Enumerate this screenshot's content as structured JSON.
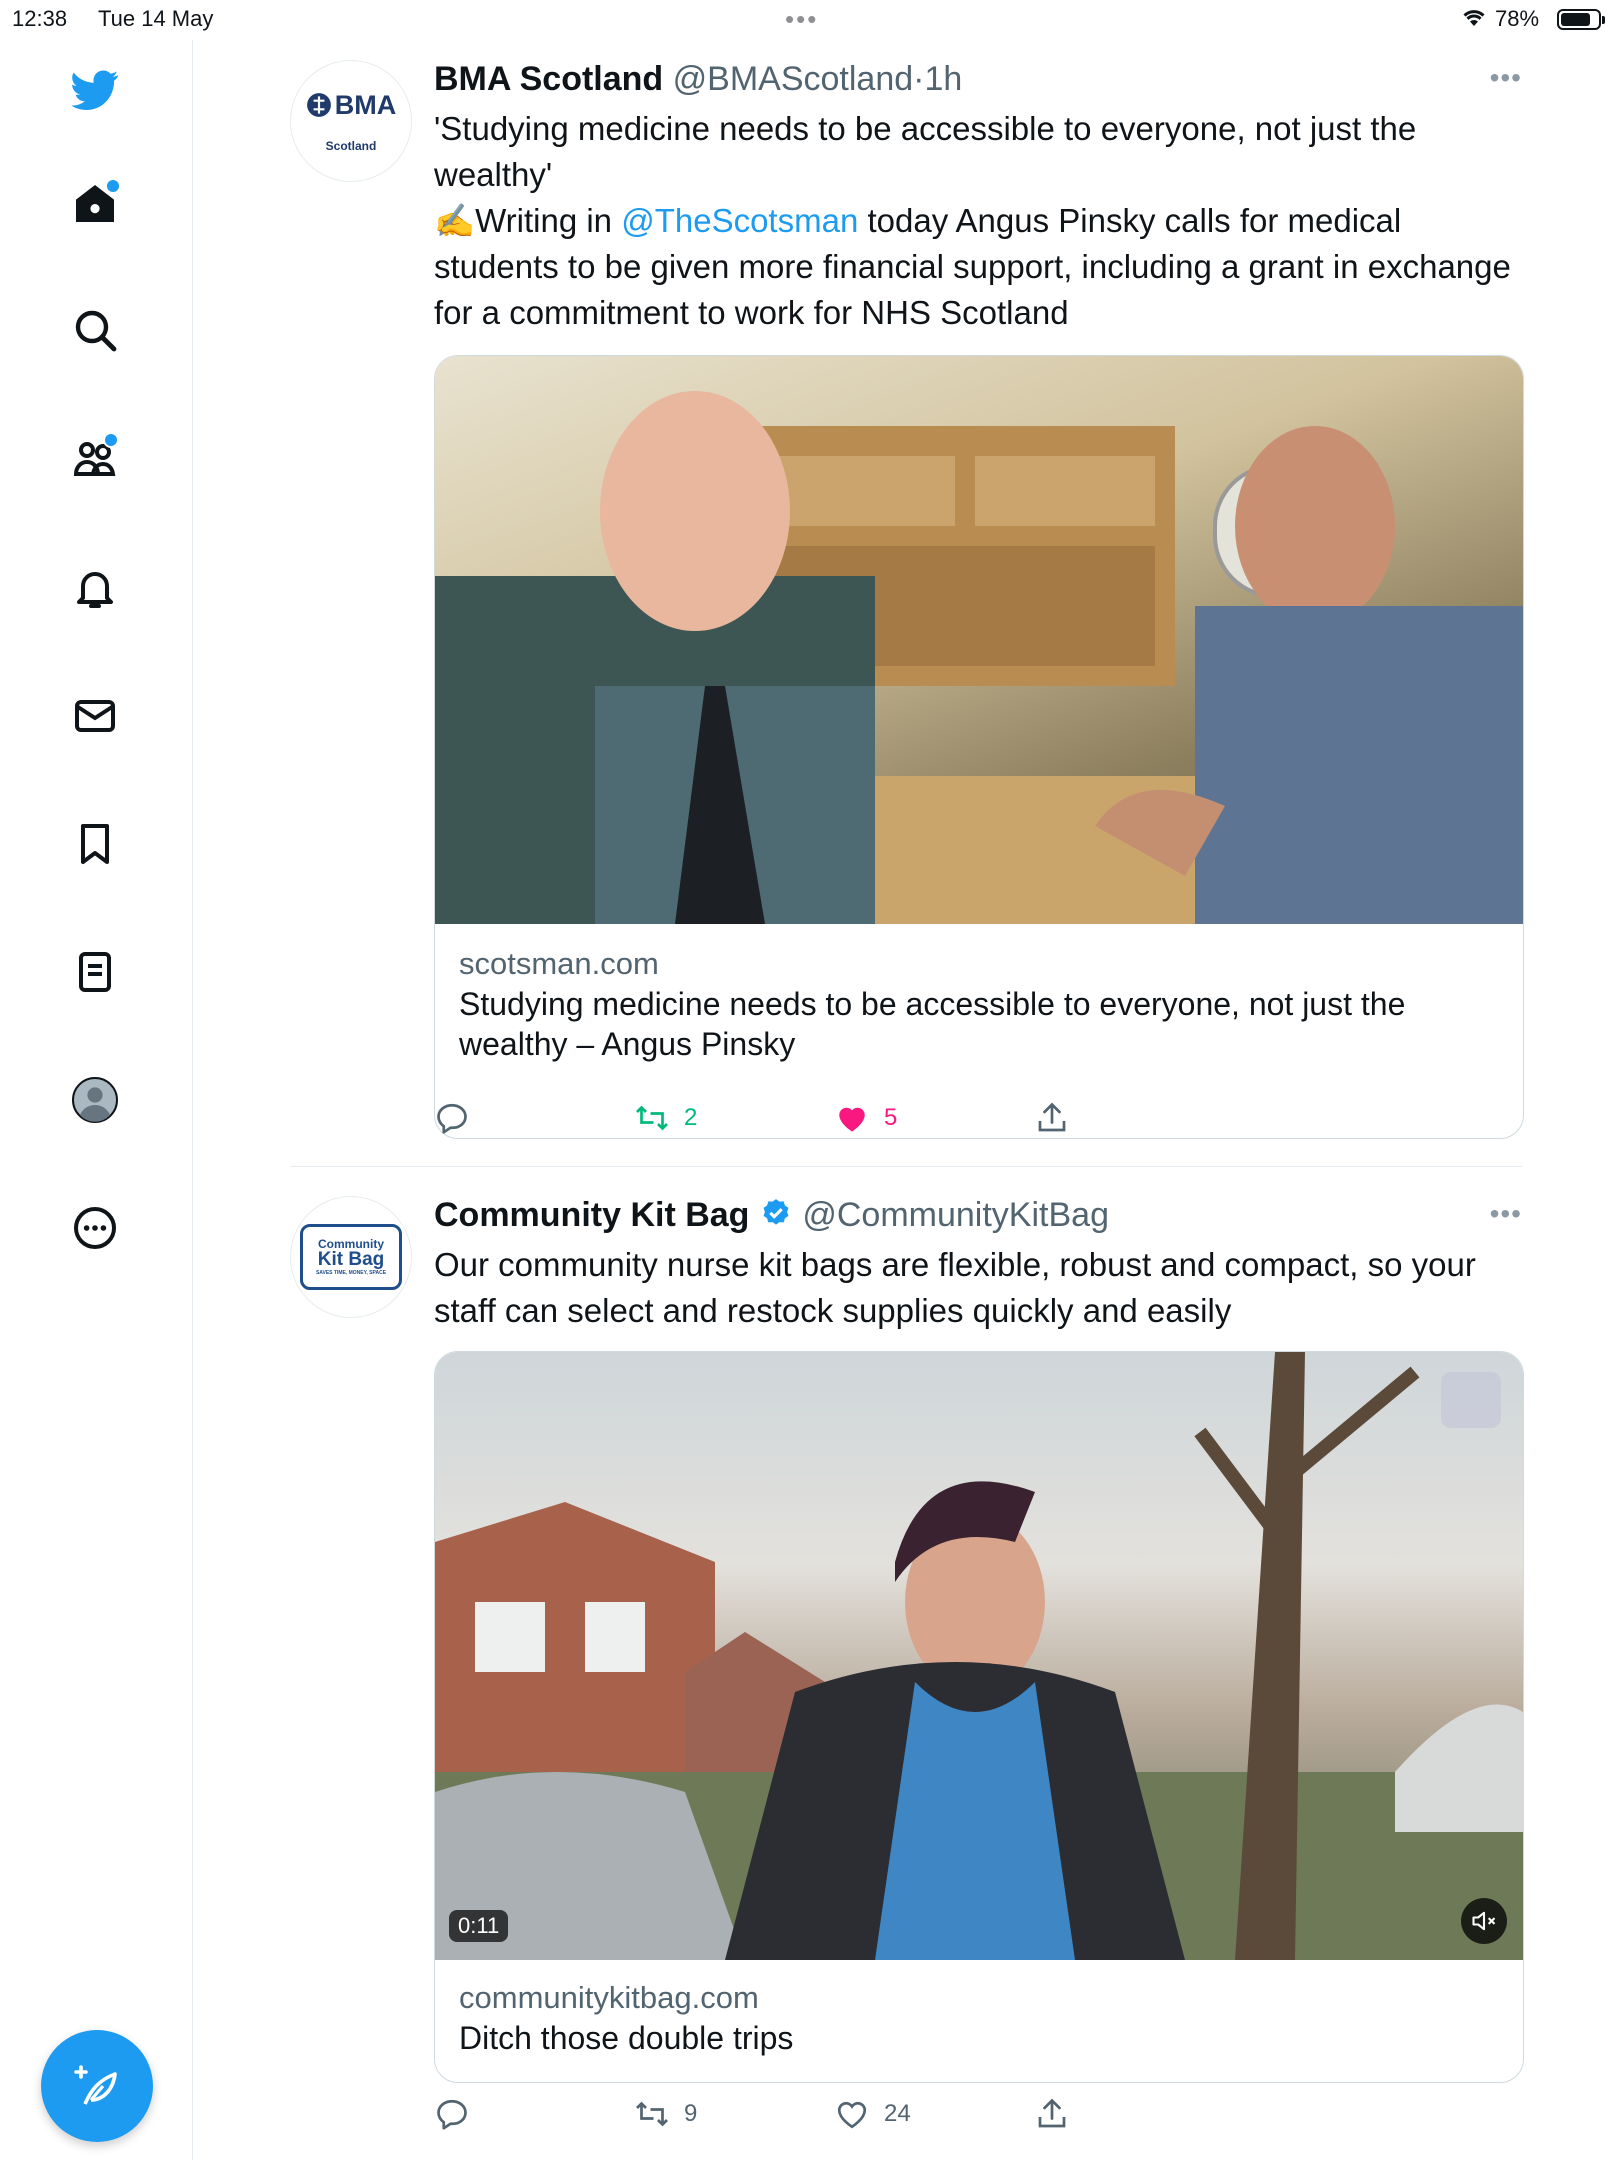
{
  "status_bar": {
    "time": "12:38",
    "date": "Tue 14 May",
    "battery": "78%"
  },
  "sidebar": {
    "items": [
      {
        "icon": "twitter-bird-icon"
      },
      {
        "icon": "home-icon"
      },
      {
        "icon": "search-icon"
      },
      {
        "icon": "communities-icon"
      },
      {
        "icon": "notifications-bell-icon"
      },
      {
        "icon": "messages-envelope-icon"
      },
      {
        "icon": "bookmark-icon"
      },
      {
        "icon": "lists-icon"
      },
      {
        "icon": "profile-avatar-icon"
      },
      {
        "icon": "more-circle-icon"
      }
    ],
    "compose_icon": "compose-feather-icon",
    "accent": "#1d9bf0"
  },
  "tweets": [
    {
      "avatar": {
        "logo_text": "BMA",
        "logo_sub": "Scotland"
      },
      "name": "BMA Scotland",
      "handle": "@BMAScotland",
      "separator": "·",
      "time": "1h",
      "text_line1": "'Studying medicine needs to be accessible to everyone, not just the wealthy'",
      "emoji": "✍️",
      "text_pre_mention": "Writing in ",
      "mention": "@TheScotsman",
      "text_post_mention": " today Angus Pinsky calls for medical students to be given more financial support, including a grant in exchange for a commitment to work for NHS Scotland",
      "card": {
        "domain": "scotsman.com",
        "title": "Studying medicine needs to be accessible to everyone, not just the wealthy – Angus Pinsky"
      },
      "actions": {
        "replies": "",
        "retweets": "2",
        "likes": "5"
      },
      "liked": true,
      "retweeted": true
    },
    {
      "avatar": {
        "logo_text": "Community",
        "logo_sub": "Kit Bag",
        "logo_tag": "SAVES TIME, MONEY, SPACE"
      },
      "name": "Community Kit Bag",
      "verified": true,
      "handle": "@CommunityKitBag",
      "text": "Our community nurse kit bags are flexible, robust and compact, so your staff can select and restock supplies quickly and easily",
      "card": {
        "video_time": "0:11",
        "domain": "communitykitbag.com",
        "title": "Ditch those double trips"
      },
      "actions": {
        "replies": "",
        "retweets": "9",
        "likes": "24"
      }
    }
  ],
  "colors": {
    "like": "#f91880",
    "retweet": "#00ba7c",
    "muted": "#536471"
  }
}
